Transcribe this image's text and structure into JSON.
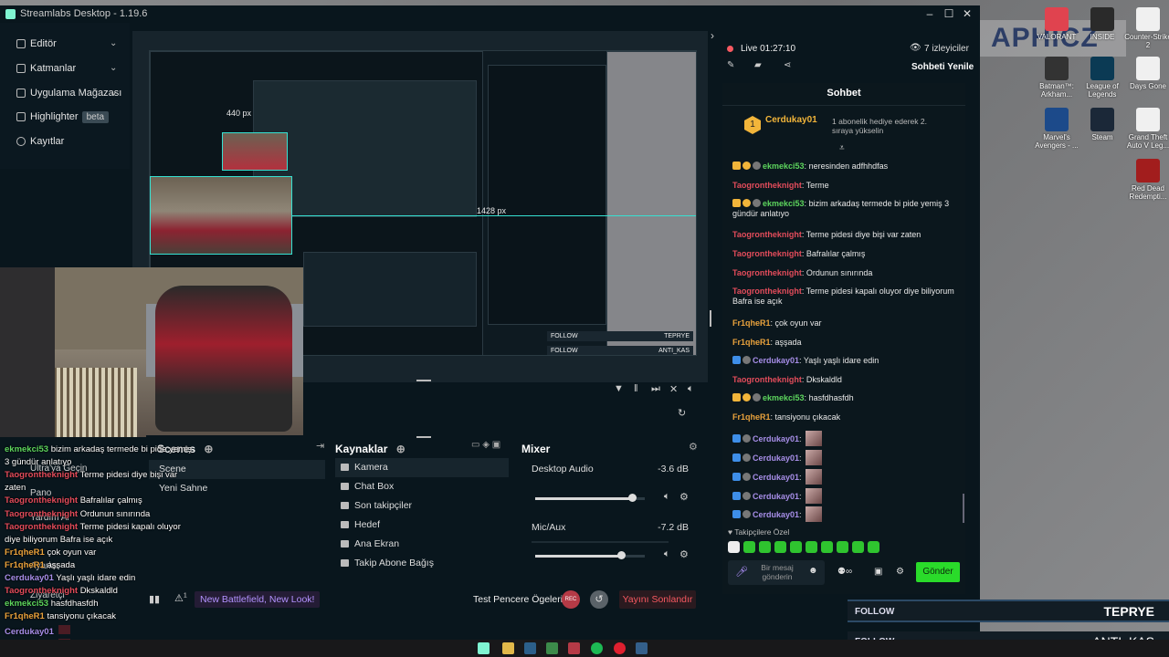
{
  "window": {
    "title": "Streamlabs Desktop - 1.19.6"
  },
  "sidebar": {
    "items": [
      {
        "label": "Editör"
      },
      {
        "label": "Katmanlar"
      },
      {
        "label": "Uygulama Mağazası"
      },
      {
        "label": "Highlighter",
        "badge": "beta"
      },
      {
        "label": "Kayıtlar"
      }
    ]
  },
  "editor": {
    "nested_size_label_1": "440 px",
    "nested_size_label_2": "1428 px"
  },
  "scenes": {
    "header": "Scenes",
    "items": [
      "Scene",
      "Yeni Sahne"
    ]
  },
  "sources": {
    "header": "Kaynaklar",
    "items": [
      "Kamera",
      "Chat Box",
      "Son takipçiler",
      "Hedef",
      "Ana Ekran",
      "Takip Abone Bağış"
    ]
  },
  "mixer": {
    "header": "Mixer",
    "channels": [
      {
        "name": "Desktop Audio",
        "db": "-3.6 dB",
        "level": 0.88
      },
      {
        "name": "Mic/Aux",
        "db": "-7.2 dB",
        "level": 0.78
      }
    ]
  },
  "footer": {
    "news": "New Battlefield, New Look!",
    "alert_count": "1",
    "test_widgets": "Test Pencere Ögeleri",
    "rec": "REC",
    "end_stream": "Yayını Sonlandır"
  },
  "live": {
    "status": "Live 01:27:10",
    "viewers": "7 izleyiciler",
    "refresh_chat": "Sohbeti Yenile"
  },
  "chat": {
    "header": "Sohbet",
    "pinned_user": "Cerdukay01",
    "pinned_level": "1",
    "pinned_note": "1 abonelik hediye ederek 2. sıraya yükselin",
    "messages": [
      {
        "user": "ekmekci53",
        "text": "neresinden adfhhdfas",
        "color": "#5dd55d"
      },
      {
        "user": "Taogrontheknight",
        "text": "Terme",
        "color": "#e34c5b"
      },
      {
        "user": "ekmekci53",
        "text": "bizim arkadaş termede bi pide yemiş 3 gündür anlatıyo",
        "color": "#5dd55d"
      },
      {
        "user": "Taogrontheknight",
        "text": "Terme pidesi diye bişi var zaten",
        "color": "#e34c5b"
      },
      {
        "user": "Taogrontheknight",
        "text": "Bafralılar çalmış",
        "color": "#e34c5b"
      },
      {
        "user": "Taogrontheknight",
        "text": "Ordunun sınırında",
        "color": "#e34c5b"
      },
      {
        "user": "Taogrontheknight",
        "text": "Terme pidesi kapalı oluyor diye biliyorum Bafra ise açık",
        "color": "#e34c5b"
      },
      {
        "user": "Fr1qheR1",
        "text": "çok oyun var",
        "color": "#e8a13c"
      },
      {
        "user": "Fr1qheR1",
        "text": "aşşada",
        "color": "#e8a13c"
      },
      {
        "user": "Cerdukay01",
        "text": "Yaşlı yaşlı idare edin",
        "color": "#a78ee8"
      },
      {
        "user": "Taogrontheknight",
        "text": "Dkskaldld",
        "color": "#e34c5b"
      },
      {
        "user": "ekmekci53",
        "text": "hasfdhasfdh",
        "color": "#5dd55d"
      },
      {
        "user": "Fr1qheR1",
        "text": "tansiyonu çıkacak",
        "color": "#e8a13c"
      },
      {
        "user": "Cerdukay01",
        "text": "",
        "color": "#a78ee8"
      },
      {
        "user": "Cerdukay01",
        "text": "",
        "color": "#a78ee8"
      },
      {
        "user": "Cerdukay01",
        "text": "",
        "color": "#a78ee8"
      },
      {
        "user": "Cerdukay01",
        "text": "",
        "color": "#a78ee8"
      },
      {
        "user": "Cerdukay01",
        "text": "",
        "color": "#a78ee8"
      }
    ],
    "followers_only": "Takipçilere Özel",
    "input_placeholder": "Bir mesaj gönderin",
    "send": "Gönder"
  },
  "overlay_chat": [
    {
      "user": "ekmekci53",
      "text": "bizim arkadaş termede bi pide yemiş",
      "color": "#5dd55d"
    },
    {
      "user": "",
      "text": "3 gündür anlatıyo",
      "color": "#ffffff"
    },
    {
      "user": "Taogrontheknight",
      "text": "Terme pidesi diye bişi var",
      "color": "#e34c5b"
    },
    {
      "user": "",
      "text": "zaten",
      "color": "#ffffff"
    },
    {
      "user": "Taogrontheknight",
      "text": "Bafralılar çalmış",
      "color": "#e34c5b"
    },
    {
      "user": "Taogrontheknight",
      "text": "Ordunun sınırında",
      "color": "#e34c5b"
    },
    {
      "user": "Taogrontheknight",
      "text": "Terme pidesi kapalı oluyor",
      "color": "#e34c5b"
    },
    {
      "user": "",
      "text": "diye biliyorum Bafra ise açık",
      "color": "#ffffff"
    },
    {
      "user": "Fr1qheR1",
      "text": "çok oyun var",
      "color": "#e8a13c"
    },
    {
      "user": "Fr1qheR1",
      "text": "aşşada",
      "color": "#e8a13c"
    },
    {
      "user": "Cerdukay01",
      "text": "Yaşlı yaşlı idare edin",
      "color": "#a78ee8"
    },
    {
      "user": "Taogrontheknight",
      "text": "Dkskaldld",
      "color": "#e34c5b"
    },
    {
      "user": "ekmekci53",
      "text": "hasfdhasfdh",
      "color": "#5dd55d"
    },
    {
      "user": "Fr1qheR1",
      "text": "tansiyonu çıkacak",
      "color": "#e8a13c"
    },
    {
      "user": "Cerdukay01",
      "text": "",
      "color": "#a78ee8"
    },
    {
      "user": "Cerdukay01",
      "text": "",
      "color": "#a78ee8"
    }
  ],
  "hidden_nav": [
    "Ultra'ya Geçin",
    "Pano",
    "Yardım Al",
    "Ayarlar",
    "Ziyaretçi"
  ],
  "follow_bars": [
    {
      "label": "FOLLOW",
      "name": "TEPRYE"
    },
    {
      "label": "FOLLOW",
      "name": "ANTI_KAS"
    }
  ],
  "desktop_icons": [
    {
      "label": "VALORANT",
      "color": "#e0434f"
    },
    {
      "label": "INSIDE",
      "color": "#2a2a2a"
    },
    {
      "label": "Counter-Strike 2",
      "color": "#f0f0f0"
    },
    {
      "label": "Batman™: Arkham...",
      "color": "#333"
    },
    {
      "label": "League of Legends",
      "color": "#0b3a54"
    },
    {
      "label": "Days Gone",
      "color": "#f0f0f0"
    },
    {
      "label": "Marvel's Avengers - ...",
      "color": "#1c4a8a"
    },
    {
      "label": "Steam",
      "color": "#1b2838"
    },
    {
      "label": "Grand Theft Auto V Leg...",
      "color": "#f0f0f0"
    },
    {
      "label": "Red Dead Redempti...",
      "color": "#a21d1d"
    }
  ],
  "banner_text": "APHICZ",
  "colors": {
    "accent": "#80f5d2",
    "send_button": "#31c3a2",
    "live_red": "#f85961",
    "end_stream": "#f85961",
    "news": "#b392ff"
  }
}
